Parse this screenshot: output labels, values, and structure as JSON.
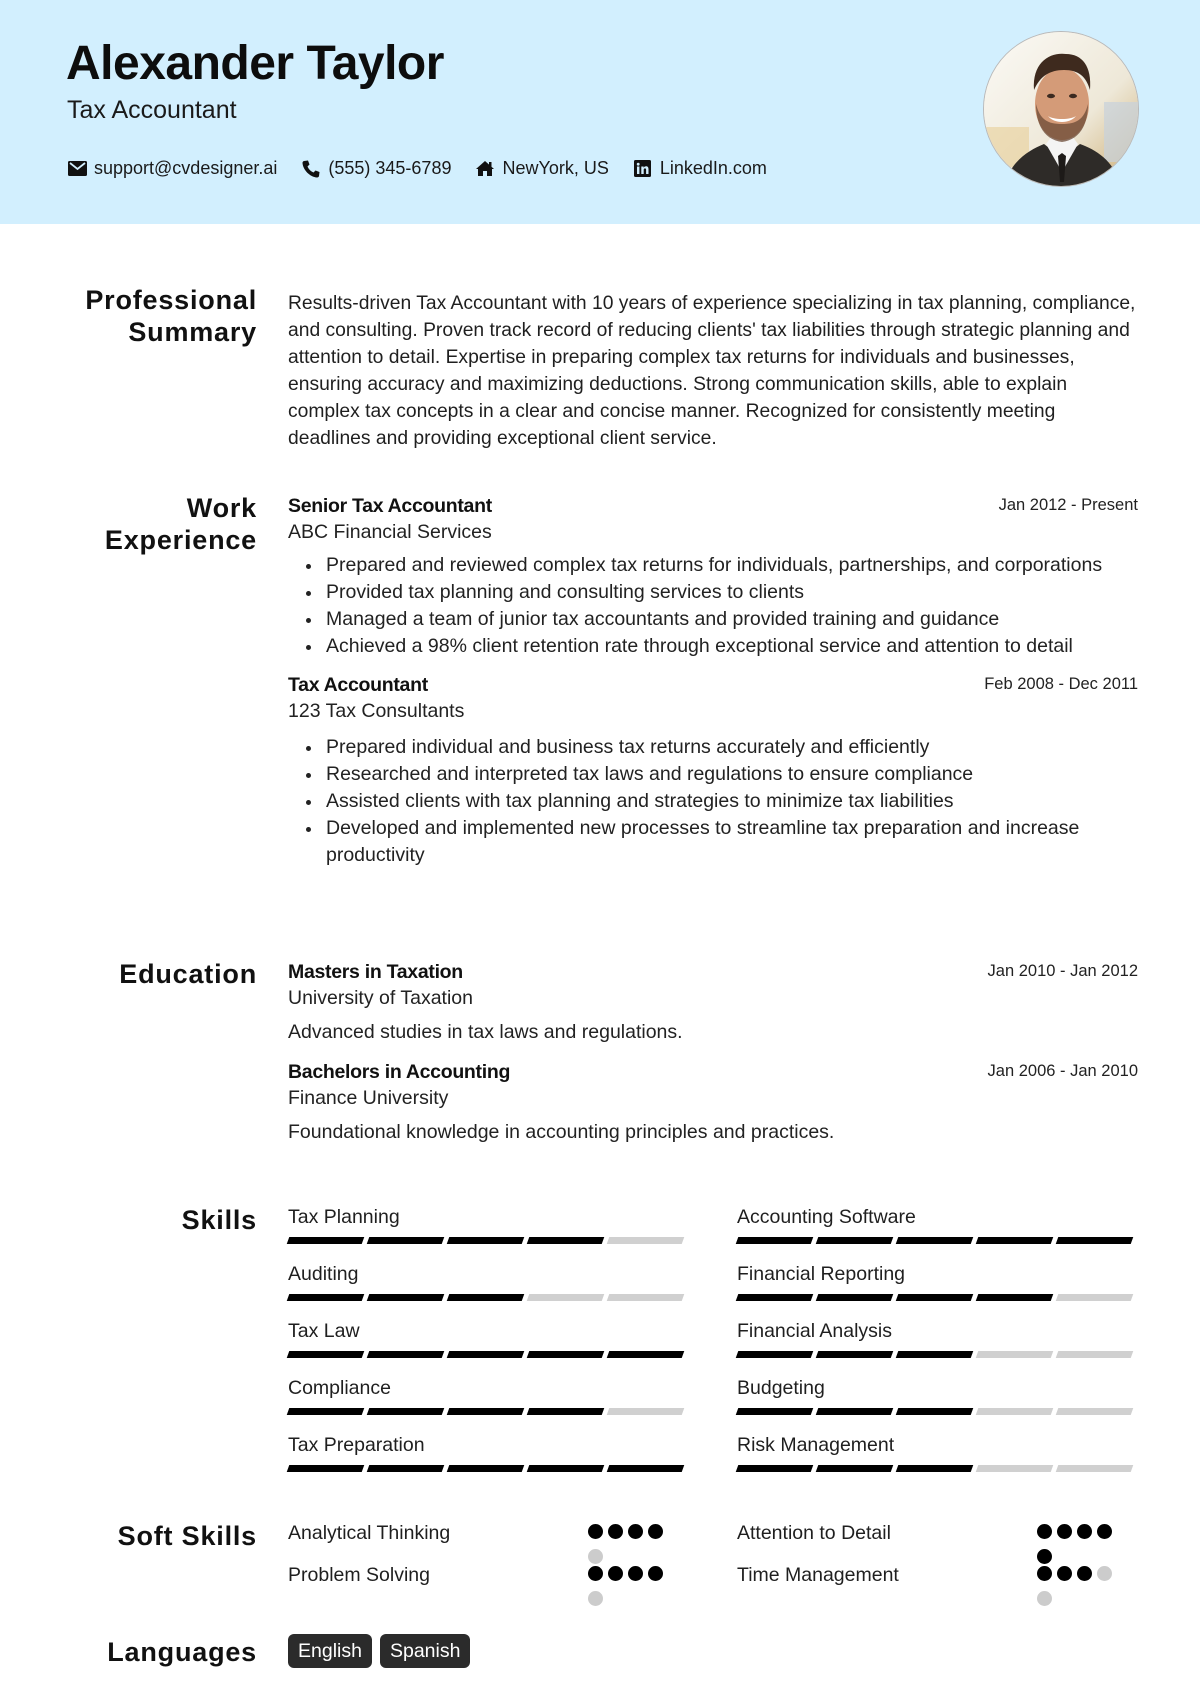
{
  "header": {
    "name": "Alexander Taylor",
    "role": "Tax Accountant",
    "contacts": [
      {
        "icon": "envelope-icon",
        "text": "support@cvdesigner.ai"
      },
      {
        "icon": "phone-icon",
        "text": "(555) 345-6789"
      },
      {
        "icon": "home-icon",
        "text": "NewYork, US"
      },
      {
        "icon": "linkedin-icon",
        "text": "LinkedIn.com"
      }
    ],
    "photo_alt": "Profile photo of a smiling man in a suit"
  },
  "colors": {
    "header_bg": "#d2effe",
    "skill_on": "#000000",
    "skill_off": "#d0d0d0",
    "badge_bg": "#2b2b2b"
  },
  "summary": {
    "title_line1": "Professional",
    "title_line2": "Summary",
    "text": "Results-driven Tax Accountant with 10 years of experience specializing in tax planning, compliance, and consulting. Proven track record of reducing clients' tax liabilities through strategic planning and attention to detail. Expertise in preparing complex tax returns for individuals and businesses, ensuring accuracy and maximizing deductions. Strong communication skills, able to explain complex tax concepts in a clear and concise manner. Recognized for consistently meeting deadlines and providing exceptional client service."
  },
  "experience": {
    "title_line1": "Work",
    "title_line2": "Experience",
    "jobs": [
      {
        "title": "Senior Tax Accountant",
        "company": "ABC Financial Services",
        "date": "Jan 2012 - Present",
        "bullets": [
          "Prepared and reviewed complex tax returns for individuals, partnerships, and corporations",
          "Provided tax planning and consulting services to clients",
          "Managed a team of junior tax accountants and provided training and guidance",
          "Achieved a 98% client retention rate through exceptional service and attention to detail"
        ]
      },
      {
        "title": "Tax Accountant",
        "company": "123 Tax Consultants",
        "date": "Feb 2008 - Dec 2011",
        "bullets": [
          "Prepared individual and business tax returns accurately and efficiently",
          "Researched and interpreted tax laws and regulations to ensure compliance",
          "Assisted clients with tax planning and strategies to minimize tax liabilities",
          "Developed and implemented new processes to streamline tax preparation and increase productivity"
        ]
      }
    ]
  },
  "education": {
    "title": "Education",
    "items": [
      {
        "degree": "Masters in Taxation",
        "school": "University of Taxation",
        "date": "Jan 2010 - Jan 2012",
        "description": "Advanced studies in tax laws and regulations."
      },
      {
        "degree": "Bachelors in Accounting",
        "school": "Finance University",
        "date": "Jan 2006 - Jan 2010",
        "description": "Foundational knowledge in accounting principles and practices."
      }
    ]
  },
  "skills": {
    "title": "Skills",
    "max_level": 5,
    "items": [
      {
        "name": "Tax Planning",
        "level": 4
      },
      {
        "name": "Accounting Software",
        "level": 5
      },
      {
        "name": "Auditing",
        "level": 3
      },
      {
        "name": "Financial Reporting",
        "level": 4
      },
      {
        "name": "Tax Law",
        "level": 5
      },
      {
        "name": "Financial Analysis",
        "level": 3
      },
      {
        "name": "Compliance",
        "level": 4
      },
      {
        "name": "Budgeting",
        "level": 3
      },
      {
        "name": "Tax Preparation",
        "level": 5
      },
      {
        "name": "Risk Management",
        "level": 3
      }
    ]
  },
  "soft_skills": {
    "title": "Soft Skills",
    "max_level": 5,
    "items": [
      {
        "name": "Analytical Thinking",
        "level": 4
      },
      {
        "name": "Attention to Detail",
        "level": 5
      },
      {
        "name": "Problem Solving",
        "level": 4
      },
      {
        "name": "Time Management",
        "level": 3
      }
    ]
  },
  "languages": {
    "title": "Languages",
    "items": [
      "English",
      "Spanish"
    ]
  }
}
